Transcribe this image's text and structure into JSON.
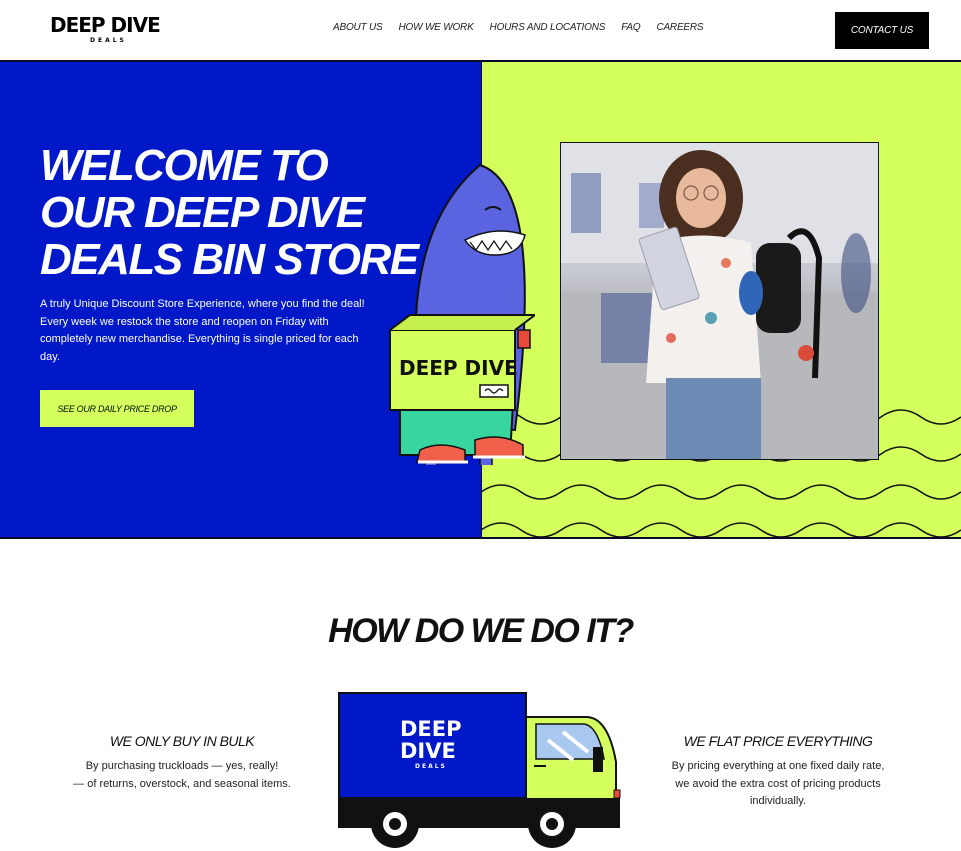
{
  "header": {
    "logo_main": "DEEP DIVE",
    "logo_sub": "DEALS",
    "nav": [
      "ABOUT US",
      "HOW WE WORK",
      "HOURS AND LOCATIONS",
      "FAQ",
      "CAREERS"
    ],
    "contact_label": "CONTACT US"
  },
  "hero": {
    "title_lines": [
      "WELCOME TO",
      "OUR DEEP DIVE",
      "DEALS BIN STORE"
    ],
    "description": "A truly Unique Discount Store Experience, where you find the deal! Every week we restock the store and reopen on Friday with completely new merchandise. Everything is single priced for each day.",
    "cta_label": "SEE OUR DAILY PRICE DROP",
    "box_text": "DEEP DIVE"
  },
  "how": {
    "title": "HOW DO WE DO IT?",
    "left": {
      "heading": "WE ONLY BUY IN BULK",
      "line1": "By purchasing truckloads — yes, really!",
      "line2": "— of returns, overstock, and seasonal items."
    },
    "right": {
      "heading": "WE FLAT PRICE EVERYTHING",
      "line1": "By pricing everything at one fixed daily rate,",
      "line2": "we avoid the extra cost of pricing products",
      "line3": "individually."
    },
    "truck_logo_line1": "DEEP",
    "truck_logo_line2": "DIVE",
    "truck_logo_line3": "DEALS"
  },
  "colors": {
    "blue": "#0018c8",
    "lime": "#d4ff5c",
    "black": "#000000"
  }
}
